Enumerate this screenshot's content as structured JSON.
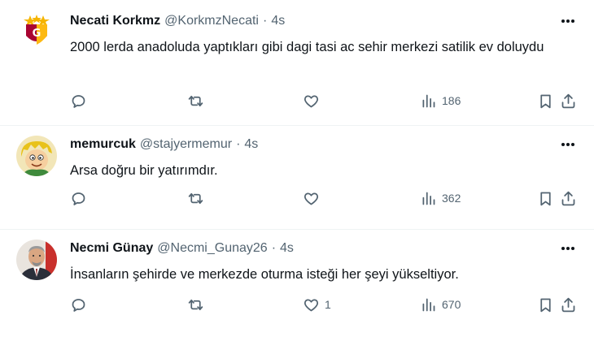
{
  "icon_color": "#536471",
  "tweets": [
    {
      "name": "Necati Korkmz",
      "handle": "@KorkmzNecati",
      "dot": "·",
      "time": "4s",
      "text": "2000 lerda anadoluda  yaptıkları gibi dagi tasi ac sehir merkezi satilik ev doluydu",
      "likes": "",
      "views": "186",
      "avatar": "galatasaray-logo-avatar"
    },
    {
      "name": "memurcuk",
      "handle": "@stajyermemur",
      "dot": "·",
      "time": "4s",
      "text": "Arsa doğru bir yatırımdır.",
      "likes": "",
      "views": "362",
      "avatar": "cartoon-character-avatar"
    },
    {
      "name": "Necmi Günay",
      "handle": "@Necmi_Gunay26",
      "dot": "·",
      "time": "4s",
      "text": "İnsanların şehirde ve merkezde oturma isteği her şeyi yükseltiyor.",
      "likes": "1",
      "views": "670",
      "avatar": "profile-photo-avatar"
    }
  ]
}
